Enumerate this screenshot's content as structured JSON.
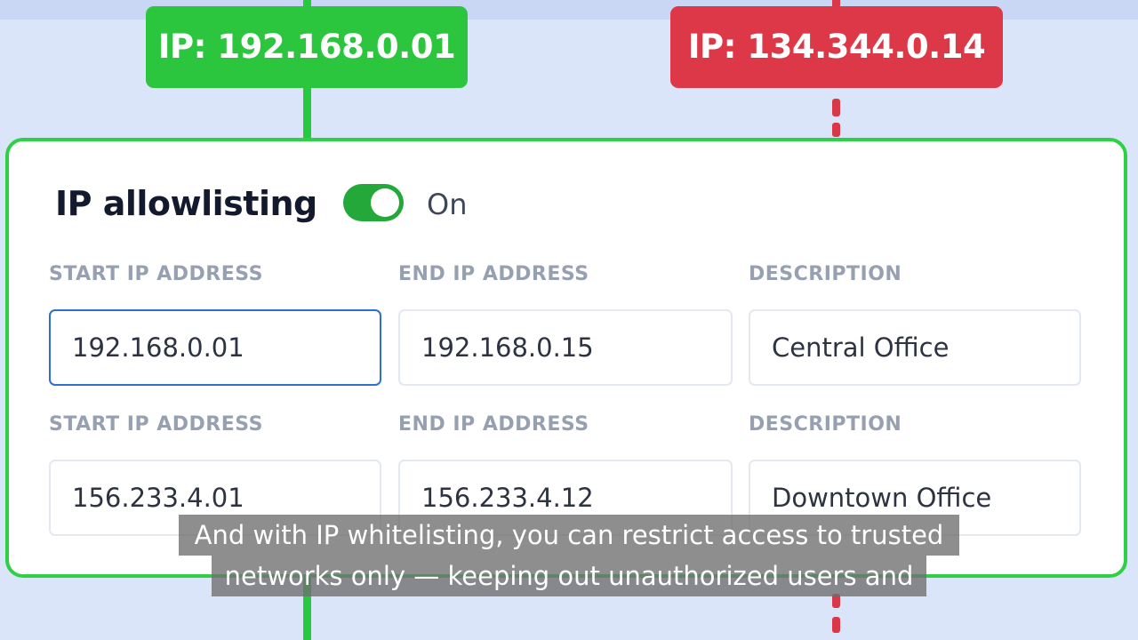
{
  "badges": {
    "allowed_ip": "IP: 192.168.0.01",
    "blocked_ip": "IP: 134.344.0.14"
  },
  "colors": {
    "allowed_green": "#2bc63e",
    "blocked_red": "#dd3847",
    "card_border": "#2fd046",
    "toggle_on": "#24a83a",
    "focus_blue": "#2f6fd0"
  },
  "panel": {
    "title": "IP allowlisting",
    "toggle_on": true,
    "toggle_state": "On",
    "rows": [
      {
        "start_label": "START IP ADDRESS",
        "end_label": "END IP ADDRESS",
        "description_label": "DESCRIPTION",
        "start_ip": "192.168.0.01",
        "end_ip": "192.168.0.15",
        "description": "Central Office"
      },
      {
        "start_label": "START IP ADDRESS",
        "end_label": "END IP ADDRESS",
        "description_label": "DESCRIPTION",
        "start_ip": "156.233.4.01",
        "end_ip": "156.233.4.12",
        "description": "Downtown Office"
      }
    ]
  },
  "caption": {
    "line1": "And with IP whitelisting, you can restrict access to trusted",
    "line2": "networks only — keeping out unauthorized users and"
  }
}
